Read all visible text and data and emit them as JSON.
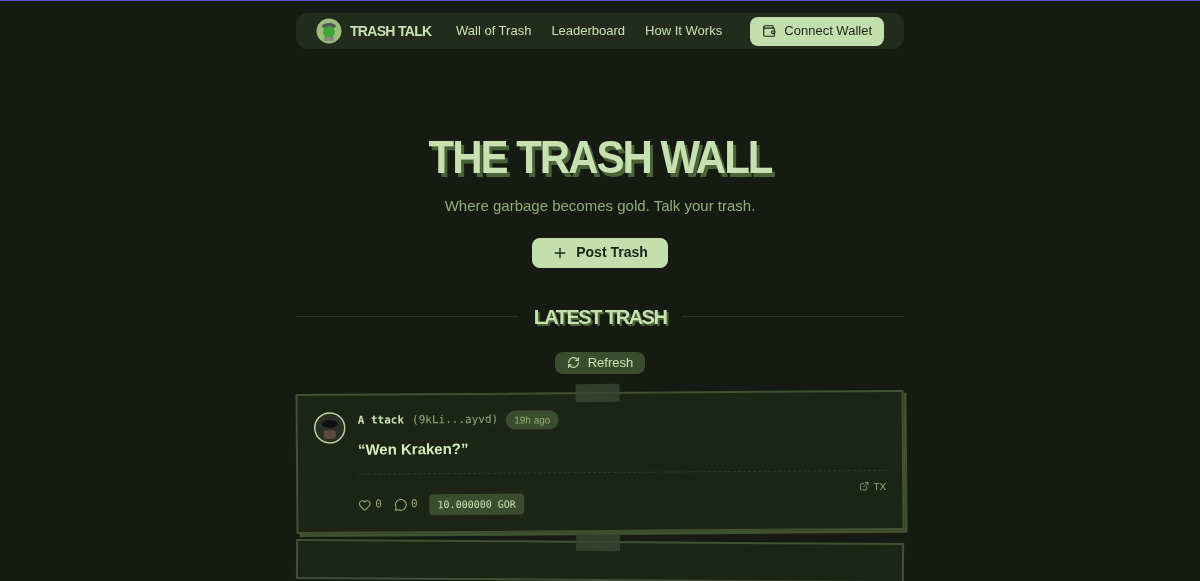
{
  "nav": {
    "brand": "TRASH TALK",
    "links": [
      "Wall of Trash",
      "Leaderboard",
      "How It Works"
    ],
    "connect_button": "Connect Wallet"
  },
  "hero": {
    "title": "THE TRASH WALL",
    "subtitle": "Where garbage becomes gold. Talk your trash.",
    "post_button": "Post Trash"
  },
  "section": {
    "title": "LATEST TRASH",
    "refresh_button": "Refresh"
  },
  "posts": [
    {
      "author": "A ttack",
      "address": "(9kLi...ayvd)",
      "time": "19h ago",
      "message": "“Wen Kraken?”",
      "likes": "0",
      "comments": "0",
      "amount": "10.000000 GOR",
      "tx": "TX"
    }
  ]
}
